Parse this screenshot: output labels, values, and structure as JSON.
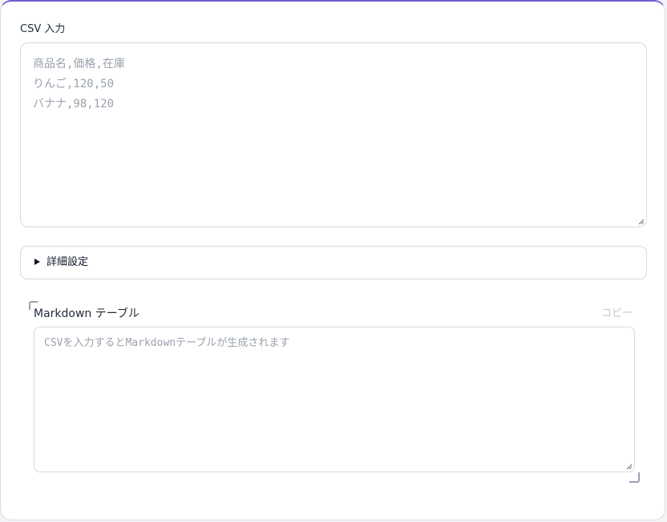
{
  "csv": {
    "label": "CSV 入力",
    "placeholder_lines": [
      "商品名,価格,在庫",
      "りんご,120,50",
      "バナナ,98,120"
    ]
  },
  "details": {
    "label": "詳細設定"
  },
  "markdown": {
    "label": "Markdown テーブル",
    "copy_label": "コピー",
    "placeholder": "CSVを入力するとMarkdownテーブルが生成されます"
  },
  "colors": {
    "accent": "#6b5fd3",
    "placeholder": "#9aa1ac",
    "border": "#d6d9df"
  },
  "icons": {
    "details_toggle": "triangle-right-icon",
    "resize_grip": "resize-grip-icon"
  }
}
